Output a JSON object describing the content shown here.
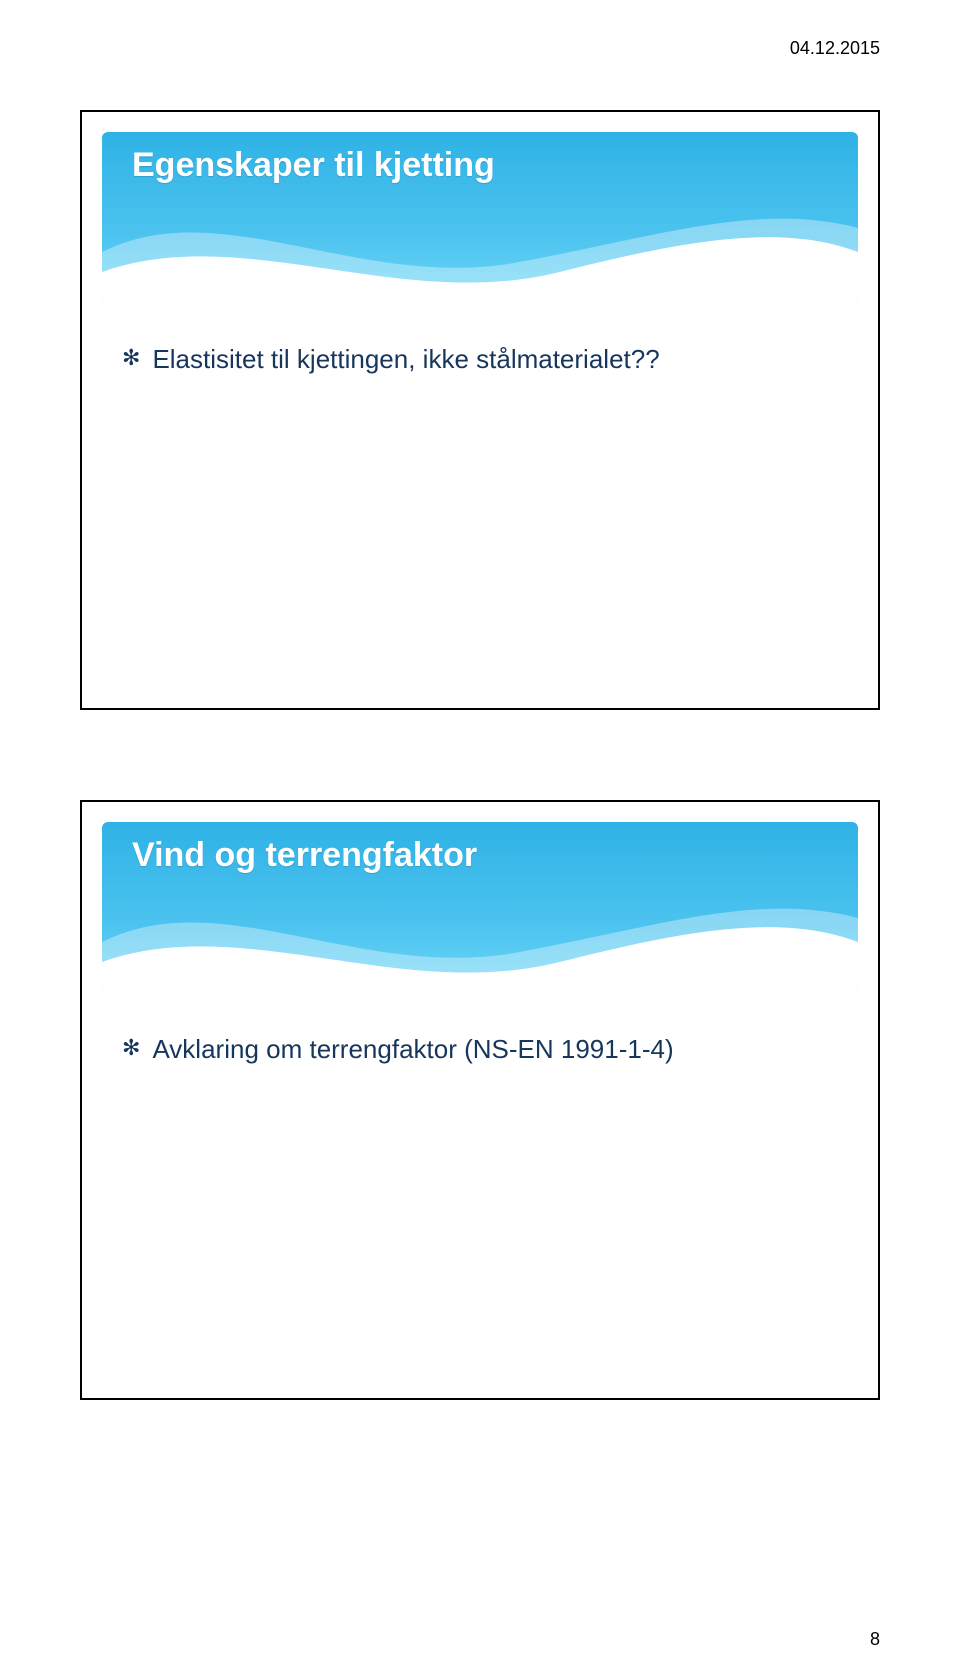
{
  "meta": {
    "date": "04.12.2015",
    "page_number": "8"
  },
  "slide1": {
    "title": "Egenskaper til kjetting",
    "bullet1": "Elastisitet til kjettingen, ikke stålmaterialet??"
  },
  "slide2": {
    "title": "Vind og terrengfaktor",
    "bullet1": "Avklaring om terrengfaktor (NS-EN 1991-1-4)"
  }
}
